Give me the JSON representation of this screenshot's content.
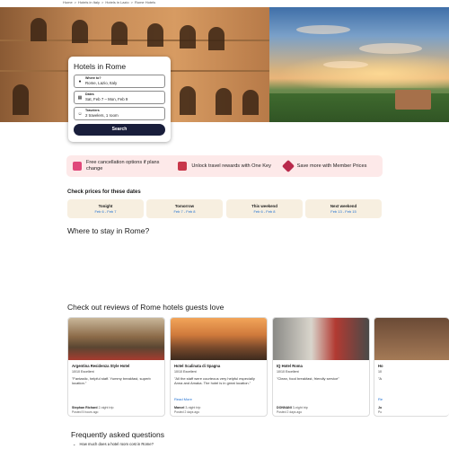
{
  "breadcrumb": [
    "Home",
    "Hotels in Italy",
    "Hotels in Lazio",
    "Rome Hotels"
  ],
  "search": {
    "title": "Hotels in Rome",
    "where_label": "Where to?",
    "where_value": "Rome, Lazio, Italy",
    "dates_label": "Dates",
    "dates_value": "Sat, Feb 7 – Mon, Feb 9",
    "travelers_label": "Travelers",
    "travelers_value": "2 travelers, 1 room",
    "button": "Search"
  },
  "promo": [
    {
      "text": "Free cancellation options if plans change",
      "icon": "calendar-icon",
      "color": "#e0487a"
    },
    {
      "text": "Unlock travel rewards with One Key",
      "icon": "key-card-icon",
      "color": "#c8374a"
    },
    {
      "text": "Save more with Member Prices",
      "icon": "tag-icon",
      "color": "#b8294b"
    }
  ],
  "prices": {
    "title": "Check prices for these dates",
    "dates": [
      {
        "label": "Tonight",
        "range": "Feb 6 - Feb 7"
      },
      {
        "label": "Tomorrow",
        "range": "Feb 7 - Feb 8"
      },
      {
        "label": "This weekend",
        "range": "Feb 6 - Feb 8"
      },
      {
        "label": "Next weekend",
        "range": "Feb 13 - Feb 15"
      }
    ]
  },
  "where_title": "Where to stay in Rome?",
  "reviews": {
    "title": "Check out reviews of Rome hotels guests love",
    "cards": [
      {
        "hotel": "Argentina Residenza Style Hotel",
        "score": "10/10 Excellent",
        "quote": "\"Fantastic, helpful staff. Yummy breakfast, superb location.\"",
        "more": "",
        "author": "Stephan Richard",
        "trip": "2-night trip",
        "posted": "Posted 5 hours ago"
      },
      {
        "hotel": "Hotel Scalinata di Spagna",
        "score": "10/10 Excellent",
        "quote": "\"All the staff were courteous very helpful especially Anna and Amaka. The hotel is in great location.\"",
        "more": "Read More",
        "author": "Marcel",
        "trip": "3-night trip",
        "posted": "Posted 2 days ago"
      },
      {
        "hotel": "IQ Hotel Roma",
        "score": "10/10 Excellent",
        "quote": "\"Clean, food breakfast, friendly service\"",
        "more": "",
        "author": "DONNANI",
        "trip": "3-night trip",
        "posted": "Posted 2 days ago"
      },
      {
        "hotel": "Ho",
        "score": "10",
        "quote": "\"A",
        "more": "Re",
        "author": "Jo",
        "trip": "",
        "posted": "Po"
      }
    ]
  },
  "faq": {
    "title": "Frequently asked questions",
    "questions": [
      "How much does a hotel room cost in Rome?"
    ]
  }
}
